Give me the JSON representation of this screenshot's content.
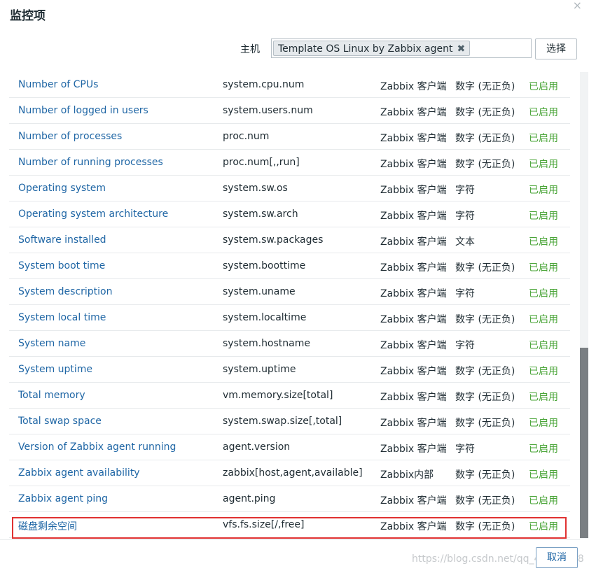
{
  "dialog": {
    "title": "监控项",
    "close_icon": "×"
  },
  "filter": {
    "host_label": "主机",
    "host_tag": "Template OS Linux by Zabbix agent",
    "tag_remove_icon": "✖",
    "select_button": "选择"
  },
  "items": [
    {
      "name": "Number of CPUs",
      "key": "system.cpu.num",
      "type": "Zabbix 客户端",
      "value_type": "数字 (无正负)",
      "status": "已启用"
    },
    {
      "name": "Number of logged in users",
      "key": "system.users.num",
      "type": "Zabbix 客户端",
      "value_type": "数字 (无正负)",
      "status": "已启用"
    },
    {
      "name": "Number of processes",
      "key": "proc.num",
      "type": "Zabbix 客户端",
      "value_type": "数字 (无正负)",
      "status": "已启用"
    },
    {
      "name": "Number of running processes",
      "key": "proc.num[,,run]",
      "type": "Zabbix 客户端",
      "value_type": "数字 (无正负)",
      "status": "已启用"
    },
    {
      "name": "Operating system",
      "key": "system.sw.os",
      "type": "Zabbix 客户端",
      "value_type": "字符",
      "status": "已启用"
    },
    {
      "name": "Operating system architecture",
      "key": "system.sw.arch",
      "type": "Zabbix 客户端",
      "value_type": "字符",
      "status": "已启用"
    },
    {
      "name": "Software installed",
      "key": "system.sw.packages",
      "type": "Zabbix 客户端",
      "value_type": "文本",
      "status": "已启用"
    },
    {
      "name": "System boot time",
      "key": "system.boottime",
      "type": "Zabbix 客户端",
      "value_type": "数字 (无正负)",
      "status": "已启用"
    },
    {
      "name": "System description",
      "key": "system.uname",
      "type": "Zabbix 客户端",
      "value_type": "字符",
      "status": "已启用"
    },
    {
      "name": "System local time",
      "key": "system.localtime",
      "type": "Zabbix 客户端",
      "value_type": "数字 (无正负)",
      "status": "已启用"
    },
    {
      "name": "System name",
      "key": "system.hostname",
      "type": "Zabbix 客户端",
      "value_type": "字符",
      "status": "已启用"
    },
    {
      "name": "System uptime",
      "key": "system.uptime",
      "type": "Zabbix 客户端",
      "value_type": "数字 (无正负)",
      "status": "已启用"
    },
    {
      "name": "Total memory",
      "key": "vm.memory.size[total]",
      "type": "Zabbix 客户端",
      "value_type": "数字 (无正负)",
      "status": "已启用"
    },
    {
      "name": "Total swap space",
      "key": "system.swap.size[,total]",
      "type": "Zabbix 客户端",
      "value_type": "数字 (无正负)",
      "status": "已启用"
    },
    {
      "name": "Version of Zabbix agent running",
      "key": "agent.version",
      "type": "Zabbix 客户端",
      "value_type": "字符",
      "status": "已启用"
    },
    {
      "name": "Zabbix agent availability",
      "key": "zabbix[host,agent,available]",
      "type": "Zabbix内部",
      "value_type": "数字 (无正负)",
      "status": "已启用"
    },
    {
      "name": "Zabbix agent ping",
      "key": "agent.ping",
      "type": "Zabbix 客户端",
      "value_type": "数字 (无正负)",
      "status": "已启用"
    },
    {
      "name": "磁盘剩余空间",
      "key": "vfs.fs.size[/,free]",
      "type": "Zabbix 客户端",
      "value_type": "数字 (无正负)",
      "status": "已启用"
    }
  ],
  "footer": {
    "cancel_button": "取消",
    "watermark": "https://blog.csdn.net/qq_44811158"
  },
  "colors": {
    "link": "#1f66a5",
    "enabled_status": "#49a437",
    "highlight_border": "#e03232"
  }
}
